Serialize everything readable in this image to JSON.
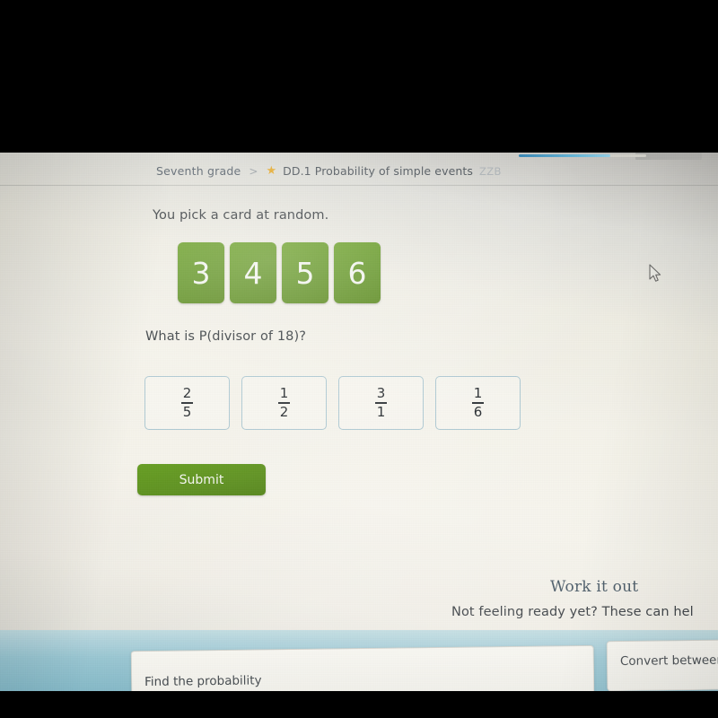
{
  "breadcrumb": {
    "grade": "Seventh grade",
    "separator": ">",
    "star_icon": "star-icon",
    "skill": "DD.1 Probability of simple events",
    "code": "ZZB"
  },
  "progress": {
    "percent": 72
  },
  "question": {
    "prompt": "You pick a card at random.",
    "cards": [
      "3",
      "4",
      "5",
      "6"
    ],
    "text": "What is P(divisor of 18)?",
    "choices": [
      {
        "numerator": "2",
        "denominator": "5"
      },
      {
        "numerator": "1",
        "denominator": "2"
      },
      {
        "numerator": "3",
        "denominator": "1"
      },
      {
        "numerator": "1",
        "denominator": "6"
      }
    ]
  },
  "actions": {
    "submit_label": "Submit"
  },
  "work_it_out": {
    "title": "Work it out",
    "subtitle": "Not feeling ready yet? These can hel",
    "recommendations": [
      {
        "label": "Find the probability"
      },
      {
        "label": "Convert between"
      }
    ]
  },
  "cursor": {
    "icon": "mouse-pointer-icon"
  },
  "colors": {
    "card_green": "#5c9318",
    "submit_green": "#5a9216",
    "choice_border": "#a9c7d2",
    "star_gold": "#e8a81d",
    "progress_blue": "#2e84b8",
    "teal_band": "#8fc4d2"
  }
}
